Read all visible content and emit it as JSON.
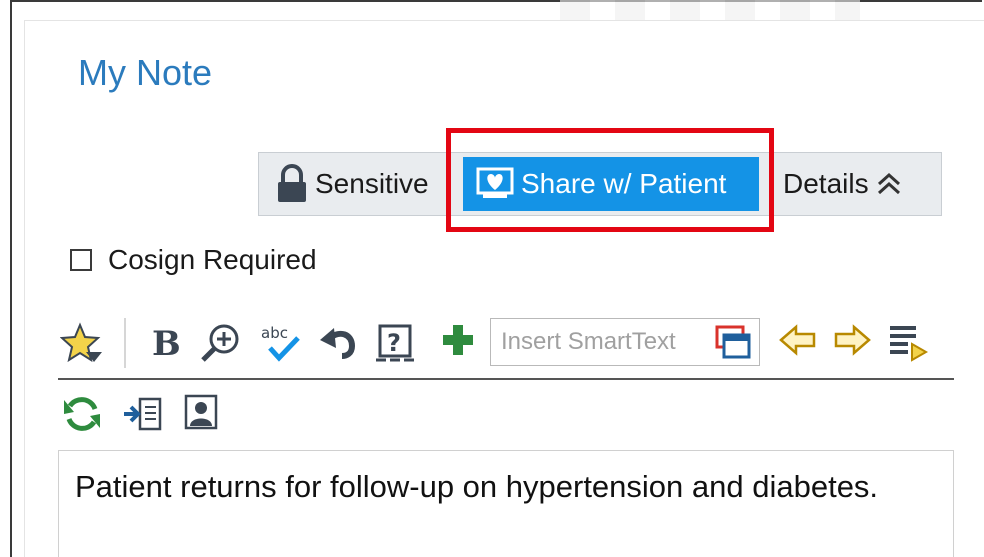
{
  "note": {
    "title": "My Note",
    "buttons": {
      "sensitive_label": "Sensitive",
      "share_label": "Share w/ Patient",
      "details_label": "Details"
    },
    "cosign_label": "Cosign Required",
    "cosign_checked": false,
    "smarttext_placeholder": "Insert SmartText",
    "body_text": "Patient returns for follow-up on hypertension and diabetes."
  },
  "toolbar_icons": [
    "star-icon",
    "bold-icon",
    "zoom-in-icon",
    "spellcheck-icon",
    "undo-icon",
    "smartphrase-help-icon",
    "add-icon",
    "smarttext-window-icon",
    "arrow-left-icon",
    "arrow-right-icon",
    "list-next-icon",
    "refresh-icon",
    "import-icon",
    "patient-photo-icon"
  ],
  "colors": {
    "title": "#2b7bbd",
    "share_button": "#1493e6",
    "highlight_box": "#e30613",
    "add_icon": "#2e8b3e",
    "arrow_icon": "#e0a800"
  }
}
